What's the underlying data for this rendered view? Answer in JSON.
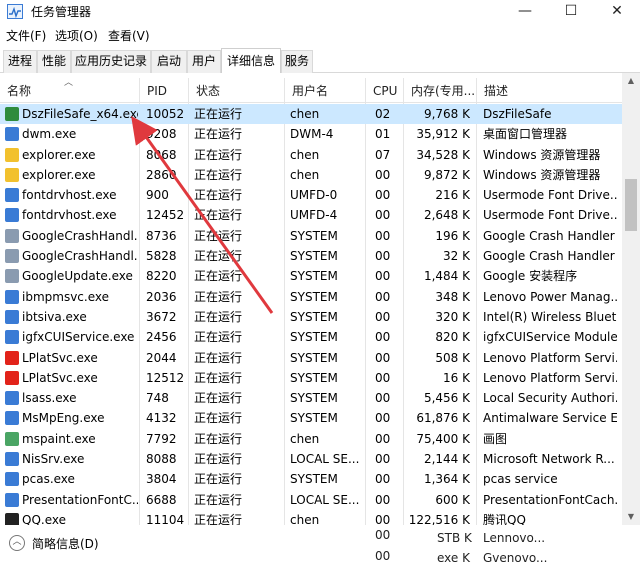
{
  "window": {
    "title": "任务管理器",
    "controls": {
      "minimize": "—",
      "maximize": "☐",
      "close": "✕"
    }
  },
  "menu": [
    "文件(F)",
    "选项(O)",
    "查看(V)"
  ],
  "tabs": [
    "进程",
    "性能",
    "应用历史记录",
    "启动",
    "用户",
    "详细信息",
    "服务"
  ],
  "active_tab": "详细信息",
  "columns": [
    "名称",
    "PID",
    "状态",
    "用户名",
    "CPU",
    "内存(专用...",
    "描述"
  ],
  "rows": [
    {
      "name": "DszFileSafe_x64.exe",
      "pid": "10052",
      "status": "正在运行",
      "user": "chen",
      "cpu": "02",
      "mem": "9,768 K",
      "desc": "DszFileSafe",
      "icon": "dszfilesafe-icon",
      "color": "#2e8b3c",
      "selected": true
    },
    {
      "name": "dwm.exe",
      "pid": "9208",
      "status": "正在运行",
      "user": "DWM-4",
      "cpu": "01",
      "mem": "35,912 K",
      "desc": "桌面窗口管理器",
      "icon": "window-icon",
      "color": "#3a7bd5"
    },
    {
      "name": "explorer.exe",
      "pid": "8068",
      "status": "正在运行",
      "user": "chen",
      "cpu": "07",
      "mem": "34,528 K",
      "desc": "Windows 资源管理器",
      "icon": "folder-icon",
      "color": "#f2c12e"
    },
    {
      "name": "explorer.exe",
      "pid": "2860",
      "status": "正在运行",
      "user": "chen",
      "cpu": "00",
      "mem": "9,872 K",
      "desc": "Windows 资源管理器",
      "icon": "folder-icon",
      "color": "#f2c12e"
    },
    {
      "name": "fontdrvhost.exe",
      "pid": "900",
      "status": "正在运行",
      "user": "UMFD-0",
      "cpu": "00",
      "mem": "216 K",
      "desc": "Usermode Font Drive...",
      "icon": "window-icon",
      "color": "#3a7bd5"
    },
    {
      "name": "fontdrvhost.exe",
      "pid": "12452",
      "status": "正在运行",
      "user": "UMFD-4",
      "cpu": "00",
      "mem": "2,648 K",
      "desc": "Usermode Font Drive...",
      "icon": "window-icon",
      "color": "#3a7bd5"
    },
    {
      "name": "GoogleCrashHandl...",
      "pid": "8736",
      "status": "正在运行",
      "user": "SYSTEM",
      "cpu": "00",
      "mem": "196 K",
      "desc": "Google Crash Handler",
      "icon": "google-icon",
      "color": "#8a9bb0"
    },
    {
      "name": "GoogleCrashHandl...",
      "pid": "5828",
      "status": "正在运行",
      "user": "SYSTEM",
      "cpu": "00",
      "mem": "32 K",
      "desc": "Google Crash Handler",
      "icon": "google-icon",
      "color": "#8a9bb0"
    },
    {
      "name": "GoogleUpdate.exe",
      "pid": "8220",
      "status": "正在运行",
      "user": "SYSTEM",
      "cpu": "00",
      "mem": "1,484 K",
      "desc": "Google 安装程序",
      "icon": "google-icon",
      "color": "#8a9bb0"
    },
    {
      "name": "ibmpmsvc.exe",
      "pid": "2036",
      "status": "正在运行",
      "user": "SYSTEM",
      "cpu": "00",
      "mem": "348 K",
      "desc": "Lenovo Power Manag...",
      "icon": "window-icon",
      "color": "#3a7bd5"
    },
    {
      "name": "ibtsiva.exe",
      "pid": "3672",
      "status": "正在运行",
      "user": "SYSTEM",
      "cpu": "00",
      "mem": "320 K",
      "desc": "Intel(R) Wireless Bluet...",
      "icon": "window-icon",
      "color": "#3a7bd5"
    },
    {
      "name": "igfxCUIService.exe",
      "pid": "2456",
      "status": "正在运行",
      "user": "SYSTEM",
      "cpu": "00",
      "mem": "820 K",
      "desc": "igfxCUIService Module",
      "icon": "window-icon",
      "color": "#3a7bd5"
    },
    {
      "name": "LPlatSvc.exe",
      "pid": "2044",
      "status": "正在运行",
      "user": "SYSTEM",
      "cpu": "00",
      "mem": "508 K",
      "desc": "Lenovo Platform Servi...",
      "icon": "lenovo-icon",
      "color": "#e2231a"
    },
    {
      "name": "LPlatSvc.exe",
      "pid": "12512",
      "status": "正在运行",
      "user": "SYSTEM",
      "cpu": "00",
      "mem": "16 K",
      "desc": "Lenovo Platform Servi...",
      "icon": "lenovo-icon",
      "color": "#e2231a"
    },
    {
      "name": "lsass.exe",
      "pid": "748",
      "status": "正在运行",
      "user": "SYSTEM",
      "cpu": "00",
      "mem": "5,456 K",
      "desc": "Local Security Authori...",
      "icon": "window-icon",
      "color": "#3a7bd5"
    },
    {
      "name": "MsMpEng.exe",
      "pid": "4132",
      "status": "正在运行",
      "user": "SYSTEM",
      "cpu": "00",
      "mem": "61,876 K",
      "desc": "Antimalware Service E...",
      "icon": "window-icon",
      "color": "#3a7bd5"
    },
    {
      "name": "mspaint.exe",
      "pid": "7792",
      "status": "正在运行",
      "user": "chen",
      "cpu": "00",
      "mem": "75,400 K",
      "desc": "画图",
      "icon": "paint-icon",
      "color": "#4aa564"
    },
    {
      "name": "NisSrv.exe",
      "pid": "8088",
      "status": "正在运行",
      "user": "LOCAL SE...",
      "cpu": "00",
      "mem": "2,144 K",
      "desc": "Microsoft Network R...",
      "icon": "window-icon",
      "color": "#3a7bd5"
    },
    {
      "name": "pcas.exe",
      "pid": "3804",
      "status": "正在运行",
      "user": "SYSTEM",
      "cpu": "00",
      "mem": "1,364 K",
      "desc": "pcas service",
      "icon": "window-icon",
      "color": "#3a7bd5"
    },
    {
      "name": "PresentationFontC...",
      "pid": "6688",
      "status": "正在运行",
      "user": "LOCAL SE...",
      "cpu": "00",
      "mem": "600 K",
      "desc": "PresentationFontCach...",
      "icon": "window-icon",
      "color": "#3a7bd5"
    },
    {
      "name": "QQ.exe",
      "pid": "11104",
      "status": "正在运行",
      "user": "chen",
      "cpu": "00",
      "mem": "122,516 K",
      "desc": "腾讯QQ",
      "icon": "qq-icon",
      "color": "#222222"
    }
  ],
  "footer": {
    "fewer_details": "简略信息(D)",
    "extra_cpu_1": "00",
    "extra_mem_1": "STB K",
    "extra_desc_1": "Lennovo...",
    "extra_cpu_2": "00",
    "extra_mem_2": "exe K",
    "extra_desc_2": "Gvenovo..."
  }
}
